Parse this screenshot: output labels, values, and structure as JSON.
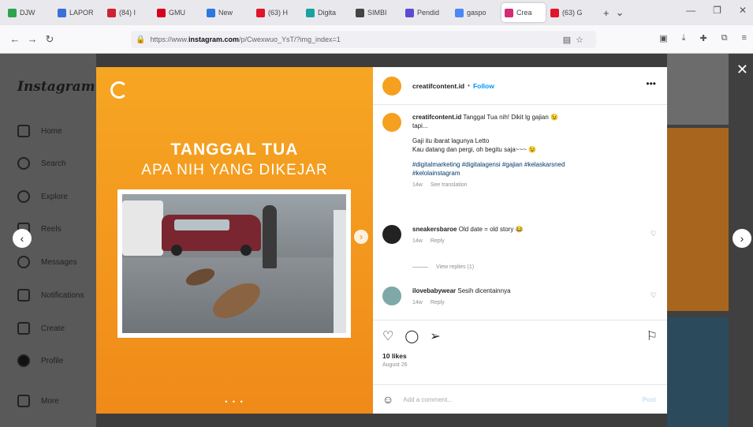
{
  "browser": {
    "tabs": [
      {
        "label": "DJW",
        "color": "#2ea44f"
      },
      {
        "label": "LAPOR",
        "color": "#3b6fd8"
      },
      {
        "label": "(84) I",
        "color": "#cc2233"
      },
      {
        "label": "GMU",
        "color": "#d6001c"
      },
      {
        "label": "New",
        "color": "#2b78e4"
      },
      {
        "label": "(63) H",
        "color": "#e0142a"
      },
      {
        "label": "Digita",
        "color": "#1aa1a1"
      },
      {
        "label": "SIMBI",
        "color": "#444444"
      },
      {
        "label": "Pendid",
        "color": "#5b4bd6"
      },
      {
        "label": "gaspo",
        "color": "#4a88f5"
      },
      {
        "label": "Crea",
        "color": "#d62976",
        "active": true
      },
      {
        "label": "(63) G",
        "color": "#e0142a"
      }
    ],
    "new_tab": "+",
    "tab_list": "⌄",
    "url_prefix": "https://www.",
    "url_host": "instagram.com",
    "url_path": "/p/Cwexwuo_YsT/?img_index=1"
  },
  "sidebar": {
    "logo": "Instagram",
    "items": [
      {
        "label": "Home",
        "icon": "home-icon"
      },
      {
        "label": "Search",
        "icon": "search-icon"
      },
      {
        "label": "Explore",
        "icon": "compass-icon"
      },
      {
        "label": "Reels",
        "icon": "reels-icon"
      },
      {
        "label": "Messages",
        "icon": "messenger-icon"
      },
      {
        "label": "Notifications",
        "icon": "heart-icon"
      },
      {
        "label": "Create",
        "icon": "plus-square-icon"
      },
      {
        "label": "Profile",
        "icon": "avatar"
      },
      {
        "label": "More",
        "icon": "menu-icon"
      }
    ]
  },
  "media": {
    "headline1": "TANGGAL TUA",
    "headline2": "APA NIH YANG DIKEJAR",
    "carousel_dots": "• • •"
  },
  "post": {
    "username": "creatifcontent.id",
    "separator": "•",
    "follow": "Follow",
    "more": "•••",
    "caption_line1": "Tanggal Tua nih! Dikit lg gajian 😉",
    "caption_line2": "tapi...",
    "caption_line3": "Gaji itu ibarat lagunya Letto",
    "caption_line4": "Kau datang dan pergi, oh begitu saja~~~ 😉",
    "hashtags1": "#digitalmarketing #digitalagensi #gajian #kelaskarsned",
    "hashtags2": "#kelolainstagram",
    "caption_time": "14w",
    "see_translation": "See translation",
    "comments": [
      {
        "user": "sneakersbaroe",
        "text": "Old date = old story 😂",
        "time": "14w",
        "reply": "Reply",
        "avatar_color": "#222222"
      },
      {
        "user": "ilovebabywear",
        "text": "Sesih dicentainnya",
        "time": "14w",
        "reply": "Reply",
        "avatar_color": "#7fa8a8"
      }
    ],
    "view_replies": "View replies (1)",
    "likes": "10 likes",
    "date": "August 26",
    "add_comment_placeholder": "Add a comment...",
    "post_btn": "Post"
  }
}
